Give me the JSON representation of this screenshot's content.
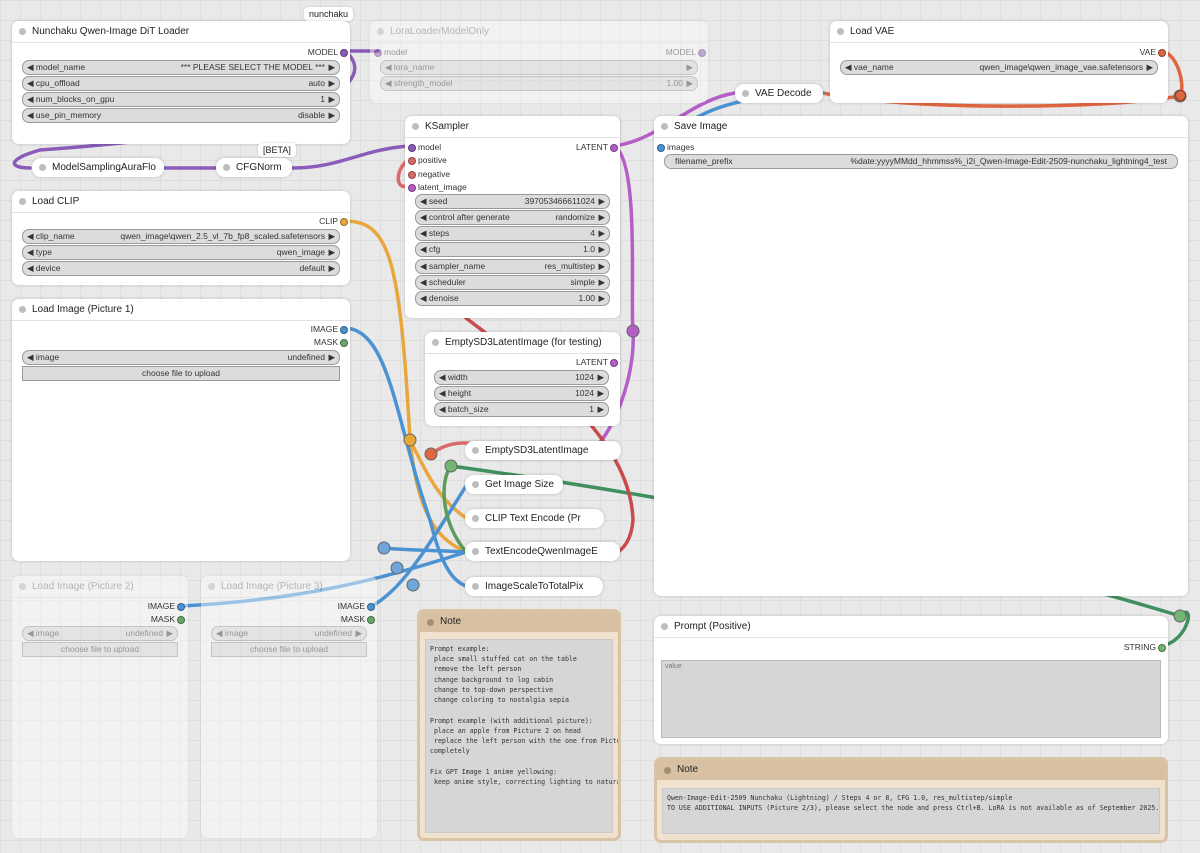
{
  "colors": {
    "model": "#8a5bb8",
    "clip": "#e8a63c",
    "image": "#4b92d3",
    "mask": "#6ba56b",
    "latent": "#b55ec8",
    "vae": "#e0663f",
    "string": "#72b672",
    "conditioning": "#d96a6a"
  },
  "nodes": {
    "dit_loader": {
      "title": "Nunchaku Qwen-Image DiT Loader",
      "badge": "nunchaku",
      "out": "MODEL",
      "widgets": [
        {
          "label": "model_name",
          "value": "*** PLEASE SELECT THE MODEL ***"
        },
        {
          "label": "cpu_offload",
          "value": "auto"
        },
        {
          "label": "num_blocks_on_gpu",
          "value": "1"
        },
        {
          "label": "use_pin_memory",
          "value": "disable"
        }
      ]
    },
    "lora": {
      "title": "LoraLoaderModelOnly",
      "in": "model",
      "out": "MODEL",
      "widgets": [
        {
          "label": "lora_name",
          "value": ""
        },
        {
          "label": "strength_model",
          "value": "1.00"
        }
      ]
    },
    "vae": {
      "title": "Load VAE",
      "out": "VAE",
      "widgets": [
        {
          "label": "vae_name",
          "value": "qwen_image\\qwen_image_vae.safetensors"
        }
      ]
    },
    "vae_decode": {
      "title": "VAE Decode"
    },
    "aura": {
      "title": "ModelSamplingAuraFlo"
    },
    "cfgnorm": {
      "title": "CFGNorm",
      "badge": "[BETA]"
    },
    "ksampler": {
      "title": "KSampler",
      "inputs": [
        "model",
        "positive",
        "negative",
        "latent_image"
      ],
      "out": "LATENT",
      "widgets": [
        {
          "label": "seed",
          "value": "397053466611024"
        },
        {
          "label": "control after generate",
          "value": "randomize"
        },
        {
          "label": "steps",
          "value": "4"
        },
        {
          "label": "cfg",
          "value": "1.0"
        },
        {
          "label": "sampler_name",
          "value": "res_multistep"
        },
        {
          "label": "scheduler",
          "value": "simple"
        },
        {
          "label": "denoise",
          "value": "1.00"
        }
      ]
    },
    "save": {
      "title": "Save Image",
      "in": "images",
      "widgets": [
        {
          "label": "filename_prefix",
          "value": "%date:yyyyMMdd_hhmmss%_i2i_Qwen-Image-Edit-2509-nunchaku_lightning4_test"
        }
      ]
    },
    "clip": {
      "title": "Load CLIP",
      "out": "CLIP",
      "widgets": [
        {
          "label": "clip_name",
          "value": "qwen_image\\qwen_2.5_vl_7b_fp8_scaled.safetensors"
        },
        {
          "label": "type",
          "value": "qwen_image"
        },
        {
          "label": "device",
          "value": "default"
        }
      ]
    },
    "img1": {
      "title": "Load Image (Picture 1)",
      "out1": "IMAGE",
      "out2": "MASK",
      "widgets": [
        {
          "label": "image",
          "value": "undefined"
        }
      ],
      "upload": "choose file to upload"
    },
    "empty_test": {
      "title": "EmptySD3LatentImage (for testing)",
      "out": "LATENT",
      "widgets": [
        {
          "label": "width",
          "value": "1024"
        },
        {
          "label": "height",
          "value": "1024"
        },
        {
          "label": "batch_size",
          "value": "1"
        }
      ]
    },
    "img2": {
      "title": "Load Image (Picture 2)",
      "out1": "IMAGE",
      "out2": "MASK",
      "widgets": [
        {
          "label": "image",
          "value": "undefined"
        }
      ],
      "upload": "choose file to upload"
    },
    "img3": {
      "title": "Load Image (Picture 3)",
      "out1": "IMAGE",
      "out2": "MASK",
      "widgets": [
        {
          "label": "image",
          "value": "undefined"
        }
      ],
      "upload": "choose file to upload"
    },
    "prompt": {
      "title": "Prompt (Positive)",
      "out": "STRING",
      "placeholder": "value"
    },
    "collapsed": [
      "EmptySD3LatentImage",
      "Get Image Size",
      "CLIP Text Encode (Pr",
      "TextEncodeQwenImageE",
      "ImageScaleToTotalPix"
    ]
  },
  "note1": {
    "title": "Note",
    "body": "Prompt example:\n place small stuffed cat on the table\n remove the left person\n change background to log cabin\n change to top-down perspective\n change coloring to nostalgia sepia\n\nPrompt example (with additional picture):\n place an apple from Picture 2 on head\n replace the left person with the one from Picture 2\ncompletely\n\nFix GPT Image 1 anime yellowing:\n keep anime style, correcting lighting to natural color"
  },
  "note2": {
    "title": "Note",
    "body": "Qwen-Image-Edit-2509 Nunchaku (Lightning) / Steps 4 or 8, CFG 1.0, res_multistep/simple\nTO USE ADDITIONAL INPUTS (Picture 2/3), please select the node and press Ctrl+B. LoRA is not available as of September 2025."
  }
}
